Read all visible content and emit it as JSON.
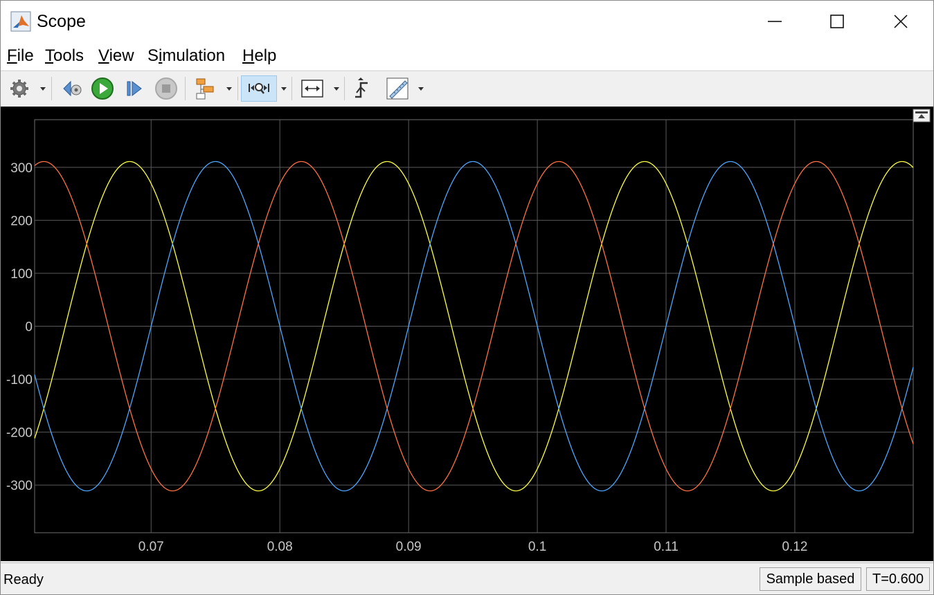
{
  "window": {
    "title": "Scope"
  },
  "menu": {
    "items": [
      {
        "label": "File"
      },
      {
        "label": "Tools"
      },
      {
        "label": "View"
      },
      {
        "label": "Simulation"
      },
      {
        "label": "Help"
      }
    ]
  },
  "toolbar": {
    "buttons": [
      {
        "icon": "gear-icon",
        "has_dropdown": true
      },
      {
        "icon": "step-back-icon",
        "has_dropdown": false
      },
      {
        "icon": "run-icon",
        "has_dropdown": false
      },
      {
        "icon": "step-forward-icon",
        "has_dropdown": false
      },
      {
        "icon": "stop-icon",
        "has_dropdown": false,
        "disabled": true
      },
      {
        "icon": "highlight-block-icon",
        "has_dropdown": true
      },
      {
        "icon": "zoom-icon",
        "has_dropdown": true,
        "active": true
      },
      {
        "icon": "scale-axes-icon",
        "has_dropdown": true
      },
      {
        "icon": "triggers-icon",
        "has_dropdown": false
      },
      {
        "icon": "measurements-icon",
        "has_dropdown": true
      }
    ]
  },
  "status": {
    "text": "Ready",
    "mode": "Sample based",
    "time": "T=0.600"
  },
  "chart_data": {
    "type": "line",
    "title": "",
    "xlabel": "",
    "ylabel": "",
    "xlim": [
      0.06095,
      0.1292
    ],
    "ylim": [
      -390,
      390
    ],
    "xticks": [
      "0.07",
      "0.08",
      "0.09",
      "0.1",
      "0.11",
      "0.12"
    ],
    "xtick_values": [
      0.07,
      0.08,
      0.09,
      0.1,
      0.11,
      0.12
    ],
    "yticks": [
      "300",
      "200",
      "100",
      "0",
      "-100",
      "-200",
      "-300"
    ],
    "ytick_values": [
      300,
      200,
      100,
      0,
      -100,
      -200,
      -300
    ],
    "grid": true,
    "background": "#000000",
    "grid_color": "#5a5a5a",
    "tick_label_color": "#c8c8c8",
    "series": [
      {
        "color": "#ffff44",
        "amplitude": 311,
        "frequency": 50,
        "phase_deg": -60,
        "function": "sin"
      },
      {
        "color": "#4da6ff",
        "amplitude": 311,
        "frequency": 50,
        "phase_deg": -180,
        "function": "sin"
      },
      {
        "color": "#ff7043",
        "amplitude": 311,
        "frequency": 50,
        "phase_deg": 60,
        "function": "sin"
      }
    ]
  }
}
